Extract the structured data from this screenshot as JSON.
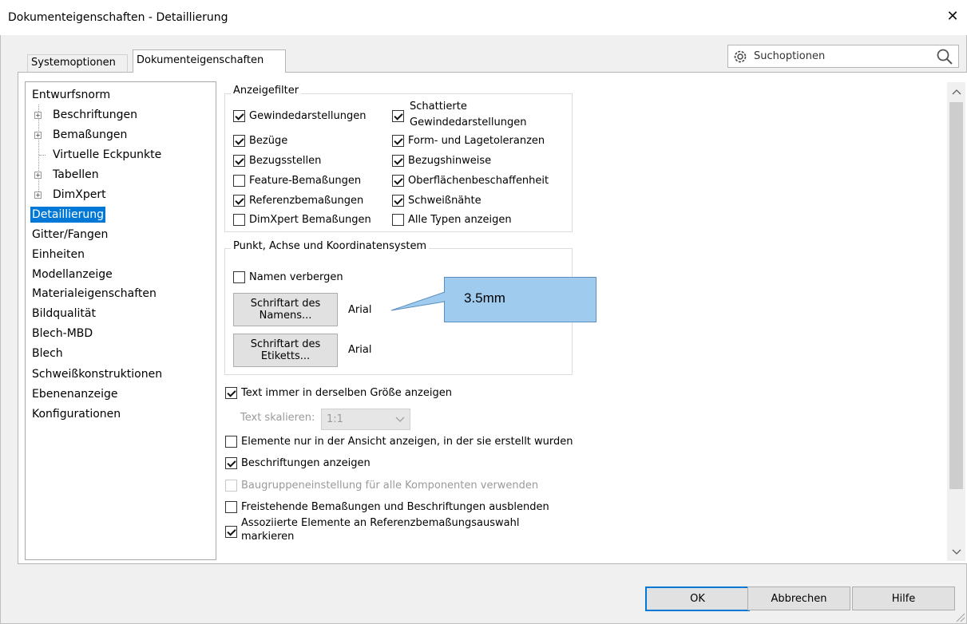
{
  "window": {
    "title": "Dokumenteigenschaften - Detaillierung",
    "close_glyph": "✕"
  },
  "tabs": [
    {
      "label": "Systemoptionen",
      "active": false
    },
    {
      "label": "Dokumenteigenschaften",
      "active": true
    }
  ],
  "search": {
    "label": "Suchoptionen",
    "gear_icon": "gear-icon",
    "magnifier_icon": "search-icon"
  },
  "tree": {
    "items": [
      {
        "label": "Entwurfsnorm",
        "level": 0
      },
      {
        "label": "Beschriftungen",
        "level": 1,
        "expandable": true
      },
      {
        "label": "Bemaßungen",
        "level": 1,
        "expandable": true
      },
      {
        "label": "Virtuelle Eckpunkte",
        "level": 1,
        "expandable": false
      },
      {
        "label": "Tabellen",
        "level": 1,
        "expandable": true
      },
      {
        "label": "DimXpert",
        "level": 1,
        "expandable": true
      },
      {
        "label": "Detaillierung",
        "level": 0,
        "selected": true
      },
      {
        "label": "Gitter/Fangen",
        "level": 0
      },
      {
        "label": "Einheiten",
        "level": 0
      },
      {
        "label": "Modellanzeige",
        "level": 0
      },
      {
        "label": "Materialeigenschaften",
        "level": 0
      },
      {
        "label": "Bildqualität",
        "level": 0
      },
      {
        "label": "Blech-MBD",
        "level": 0
      },
      {
        "label": "Blech",
        "level": 0
      },
      {
        "label": "Schweißkonstruktionen",
        "level": 0
      },
      {
        "label": "Ebenenanzeige",
        "level": 0
      },
      {
        "label": "Konfigurationen",
        "level": 0
      }
    ]
  },
  "anzeigefilter": {
    "title": "Anzeigefilter",
    "left": [
      {
        "label": "Gewindedarstellungen",
        "checked": true
      },
      {
        "label": "Bezüge",
        "checked": true
      },
      {
        "label": "Bezugsstellen",
        "checked": true
      },
      {
        "label": "Feature-Bemaßungen",
        "checked": false
      },
      {
        "label": "Referenzbemaßungen",
        "checked": true
      },
      {
        "label": "DimXpert Bemaßungen",
        "checked": false
      }
    ],
    "right": [
      {
        "label": "Schattierte",
        "label2": "Gewindedarstellungen",
        "checked": true
      },
      {
        "label": "Form- und Lagetoleranzen",
        "checked": true
      },
      {
        "label": "Bezugshinweise",
        "checked": true
      },
      {
        "label": "Oberflächenbeschaffenheit",
        "checked": true
      },
      {
        "label": "Schweißnähte",
        "checked": true
      },
      {
        "label": "Alle Typen anzeigen",
        "checked": false
      }
    ]
  },
  "punkt_group": {
    "title": "Punkt, Achse und Koordinatensystem",
    "hide_names": {
      "label": "Namen verbergen",
      "checked": false
    },
    "name_font_button": {
      "line1": "Schriftart des",
      "line2": "Namens..."
    },
    "name_font_value": "Arial",
    "label_font_button": {
      "line1": "Schriftart des",
      "line2": "Etiketts..."
    },
    "label_font_value": "Arial"
  },
  "callout": {
    "text": "3.5mm"
  },
  "options": {
    "same_size": {
      "label": "Text immer in derselben Größe anzeigen",
      "checked": true
    },
    "scale_label": "Text skalieren:",
    "scale_value": "1:1",
    "only_in_view": {
      "label": "Elemente nur in der Ansicht anzeigen, in der sie erstellt wurden",
      "checked": false
    },
    "show_annotations": {
      "label": "Beschriftungen anzeigen",
      "checked": true
    },
    "assembly_setting": {
      "label": "Baugruppeneinstellung für alle Komponenten verwenden",
      "checked": false,
      "disabled": true
    },
    "hide_dangling": {
      "label": "Freistehende Bemaßungen und Beschriftungen ausblenden",
      "checked": false
    },
    "associated": {
      "label": "Assoziierte Elemente an Referenzbemaßungsauswahl",
      "label2": "markieren",
      "checked": true
    }
  },
  "footer": {
    "ok": "OK",
    "cancel": "Abbrechen",
    "help": "Hilfe"
  }
}
